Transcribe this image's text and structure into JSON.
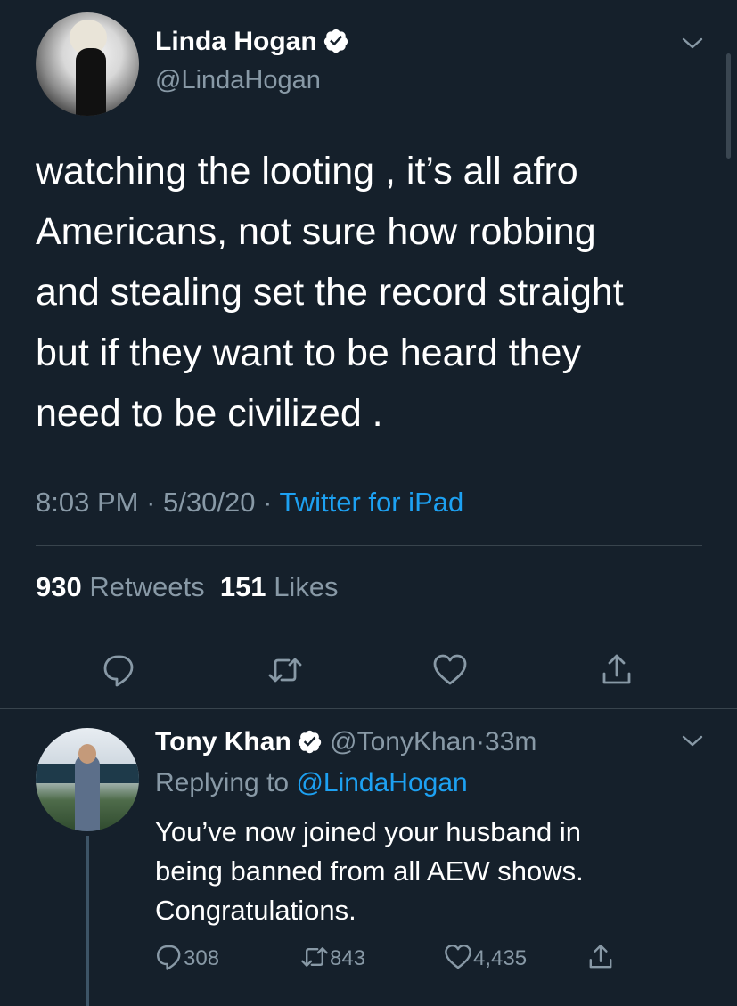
{
  "colors": {
    "background": "#15202b",
    "text_primary": "#ffffff",
    "text_secondary": "#8899a6",
    "link": "#1da1f2",
    "divider": "#38444d"
  },
  "main_tweet": {
    "display_name": "Linda Hogan",
    "handle": "@LindaHogan",
    "verified_icon": "verified-badge-icon",
    "text_lines": [
      "watching the looting , it’s all afro",
      "Americans, not sure how robbing",
      "and stealing set the record straight",
      "but if they want to be heard they",
      "need to be civilized ."
    ],
    "time": "8:03 PM",
    "date": "5/30/20",
    "separator": "·",
    "source": "Twitter for iPad",
    "retweets_count": "930",
    "retweets_label": "Retweets",
    "likes_count": "151",
    "likes_label": "Likes",
    "actions": [
      "reply-icon",
      "retweet-icon",
      "like-icon",
      "share-icon"
    ]
  },
  "reply_tweet": {
    "display_name": "Tony Khan",
    "handle": "@TonyKhan",
    "separator": "·",
    "age": "33m",
    "replying_prefix": "Replying to",
    "replying_to": "@LindaHogan",
    "text_lines": [
      "You’ve now joined your husband in",
      "being banned from all AEW shows.",
      "Congratulations."
    ],
    "reply_count": "308",
    "retweet_count": "843",
    "like_count": "4,435"
  }
}
